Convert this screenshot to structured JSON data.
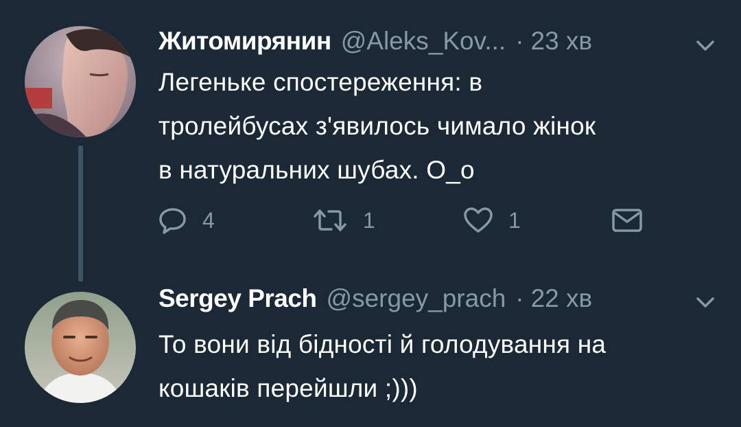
{
  "tweets": [
    {
      "author_name": "Житомирянин",
      "handle": "@Aleks_Kov...",
      "separator": "·",
      "time": "23 хв",
      "text_lines": [
        "Легеньке спостереження: в",
        "тролейбусах з'явилось чимало жінок",
        "в натуральних шубах. О_о"
      ],
      "reply_count": "4",
      "retweet_count": "1",
      "like_count": "1",
      "avatar_icon": "user-avatar-photo"
    },
    {
      "author_name": "Sergey Prach",
      "handle": "@sergey_prach",
      "separator": "·",
      "time": "22 хв",
      "text_lines": [
        "То вони від бідності й голодування на",
        "кошаків перейшли ;)))"
      ],
      "avatar_icon": "user-avatar-photo"
    }
  ],
  "colors": {
    "background": "#1b2836",
    "primary_text": "#ffffff",
    "secondary_text": "#8899a6",
    "thread_line": "#3d5466"
  },
  "icons": [
    "reply-icon",
    "retweet-icon",
    "like-icon",
    "direct-message-icon",
    "chevron-down-icon"
  ]
}
